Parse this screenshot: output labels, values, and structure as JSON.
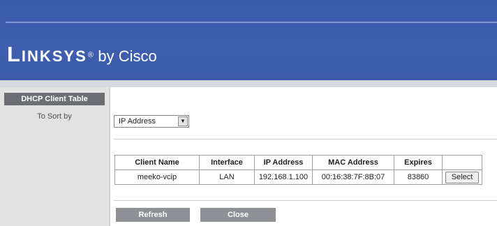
{
  "brand": {
    "name": "Linksys",
    "registered": "®",
    "sub": "by Cisco"
  },
  "sidebar": {
    "section_title": "DHCP Client Table",
    "sort_label": "To Sort by"
  },
  "sort_select": {
    "value": "IP Address"
  },
  "table": {
    "headers": [
      "Client Name",
      "Interface",
      "IP Address",
      "MAC Address",
      "Expires"
    ],
    "rows": [
      {
        "client_name": "meeko-vcip",
        "interface": "LAN",
        "ip_address": "192.168.1.100",
        "mac_address": "00:16:38:7F:8B:07",
        "expires": "83860",
        "action": "Select"
      }
    ]
  },
  "buttons": {
    "refresh": "Refresh",
    "close": "Close"
  },
  "colors": {
    "banner": "#3f5fae",
    "sidebar_head": "#6b6f74",
    "button": "#8e9296"
  }
}
